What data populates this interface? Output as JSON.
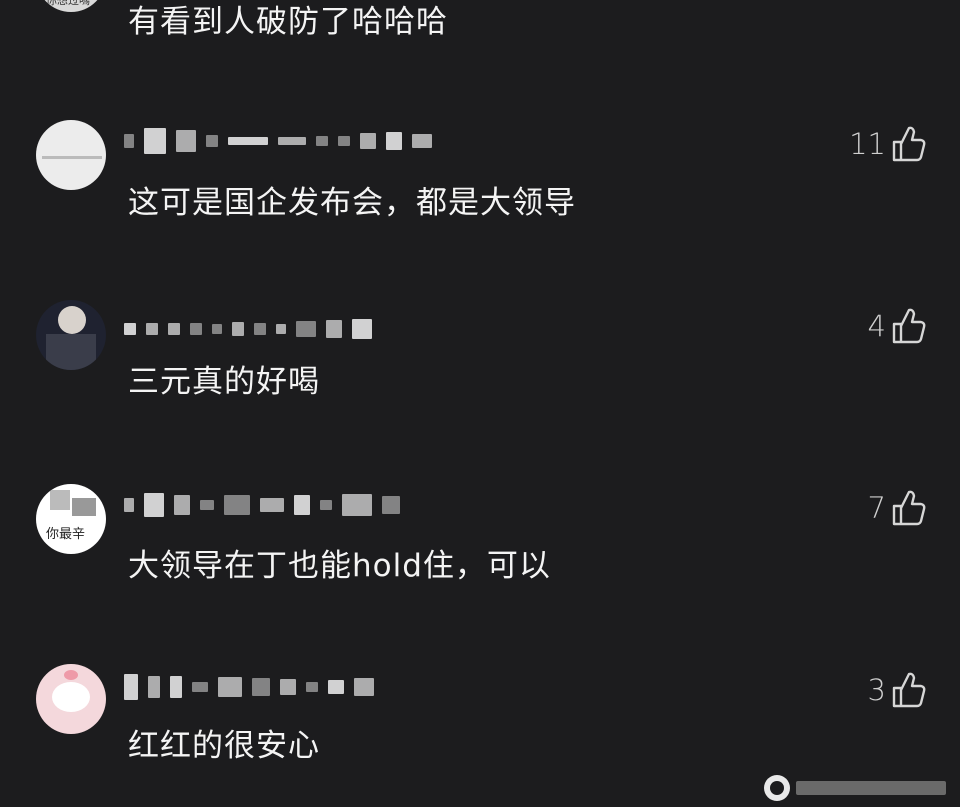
{
  "colors": {
    "background": "#1c1c1e",
    "text": "#f4f4f4",
    "like": "#cfcfcf"
  },
  "comments": [
    {
      "text": "有看到人破防了哈哈哈",
      "like_count": "",
      "avatar_caption": "你想过嗎"
    },
    {
      "text": "这可是国企发布会，都是大领导",
      "like_count": "11",
      "avatar_caption": ""
    },
    {
      "text": "三元真的好喝",
      "like_count": "4",
      "avatar_caption": ""
    },
    {
      "text": "大领导在丁也能hold住，可以",
      "like_count": "7",
      "avatar_caption": "你最辛"
    },
    {
      "text": "红红的很安心",
      "like_count": "3",
      "avatar_caption": ""
    }
  ],
  "icons": {
    "like": "thumbs-up-icon",
    "watermark": "weibo-logo-icon"
  }
}
